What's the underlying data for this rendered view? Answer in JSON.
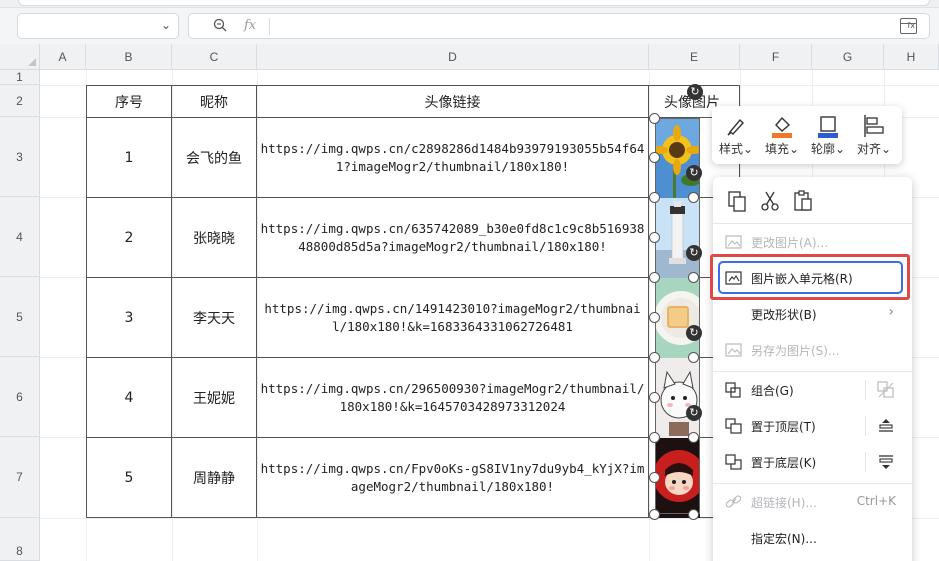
{
  "formula_bar": {
    "fx_label": "fx",
    "name_value": ""
  },
  "columns": [
    "A",
    "B",
    "C",
    "D",
    "E",
    "F",
    "G",
    "H"
  ],
  "rows": [
    "1",
    "2",
    "3",
    "4",
    "5",
    "6",
    "7",
    "8"
  ],
  "table": {
    "headers": [
      "序号",
      "昵称",
      "头像链接",
      "头像图片"
    ],
    "rows": [
      {
        "no": "1",
        "name": "会飞的鱼",
        "url": "https://img.qwps.cn/c2898286d1484b93979193055b54f641?imageMogr2/thumbnail/180x180!"
      },
      {
        "no": "2",
        "name": "张晓晓",
        "url": "https://img.qwps.cn/635742089_b30e0fd8c1c9c8b51693848800d85d5a?imageMogr2/thumbnail/180x180!"
      },
      {
        "no": "3",
        "name": "李天天",
        "url": "https://img.qwps.cn/1491423010?imageMogr2/thumbnail/180x180!&k=1683364331062726481"
      },
      {
        "no": "4",
        "name": "王妮妮",
        "url": "https://img.qwps.cn/296500930?imageMogr2/thumbnail/180x180!&k=1645703428973312024"
      },
      {
        "no": "5",
        "name": "周静静",
        "url": "https://img.qwps.cn/Fpv0oKs-gS8IV1ny7du9yb4_kYjX?imageMogr2/thumbnail/180x180!"
      }
    ]
  },
  "float_toolbar": {
    "style": "样式",
    "fill": "填充",
    "outline": "轮廓",
    "align": "对齐"
  },
  "context_menu": {
    "change_picture": "更改图片(A)...",
    "embed_in_cell": "图片嵌入单元格(R)",
    "change_shape": "更改形状(B)",
    "save_as_picture": "另存为图片(S)...",
    "group": "组合(G)",
    "bring_to_front": "置于顶层(T)",
    "send_to_back": "置于底层(K)",
    "hyperlink": "超链接(H)...",
    "hyperlink_shortcut": "Ctrl+K",
    "assign_macro": "指定宏(N)..."
  },
  "colors": {
    "highlight_red": "#e04848",
    "highlight_blue": "#3a6cf0",
    "fill_orange": "#f07828",
    "outline_blue": "#2f5bd3"
  }
}
